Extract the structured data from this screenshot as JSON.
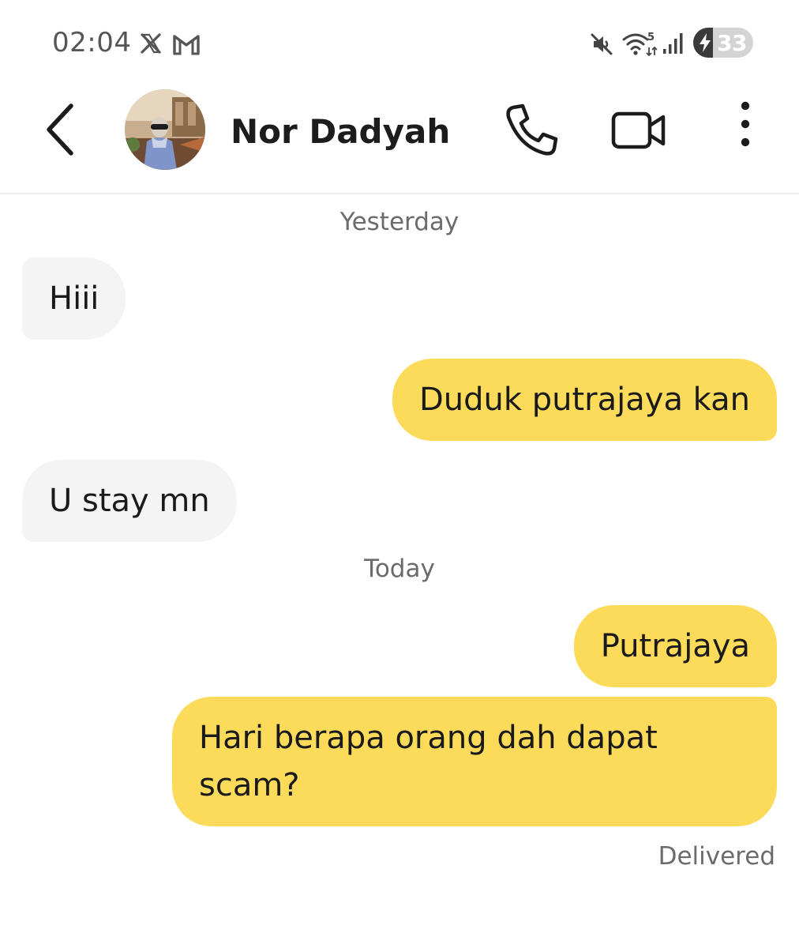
{
  "status_bar": {
    "time": "02:04",
    "notification_icons": [
      "x-icon",
      "gmail-icon"
    ],
    "system_icons": [
      "mute-icon",
      "wifi-icon",
      "signal-icon"
    ],
    "wifi_badge": "5",
    "battery_level": 33,
    "battery_label": "33",
    "battery_charging": true
  },
  "header": {
    "contact_name": "Nor Dadyah",
    "icons": {
      "back": "chevron-left-icon",
      "call": "phone-icon",
      "video": "video-camera-icon",
      "more": "more-vertical-icon"
    }
  },
  "conversation": {
    "separators": {
      "first": "Yesterday",
      "second": "Today"
    },
    "messages": [
      {
        "direction": "incoming",
        "text": "Hiii"
      },
      {
        "direction": "outgoing",
        "text": "Duduk putrajaya kan"
      },
      {
        "direction": "incoming",
        "text": "U stay mn"
      },
      {
        "direction": "outgoing",
        "text": "Putrajaya"
      },
      {
        "direction": "outgoing",
        "text": "Hari berapa orang dah dapat scam?"
      }
    ],
    "delivery_status": "Delivered"
  },
  "colors": {
    "outgoing_bubble": "#fddb5a",
    "incoming_bubble": "#f4f4f4",
    "secondary_text": "#6b6b6b"
  }
}
